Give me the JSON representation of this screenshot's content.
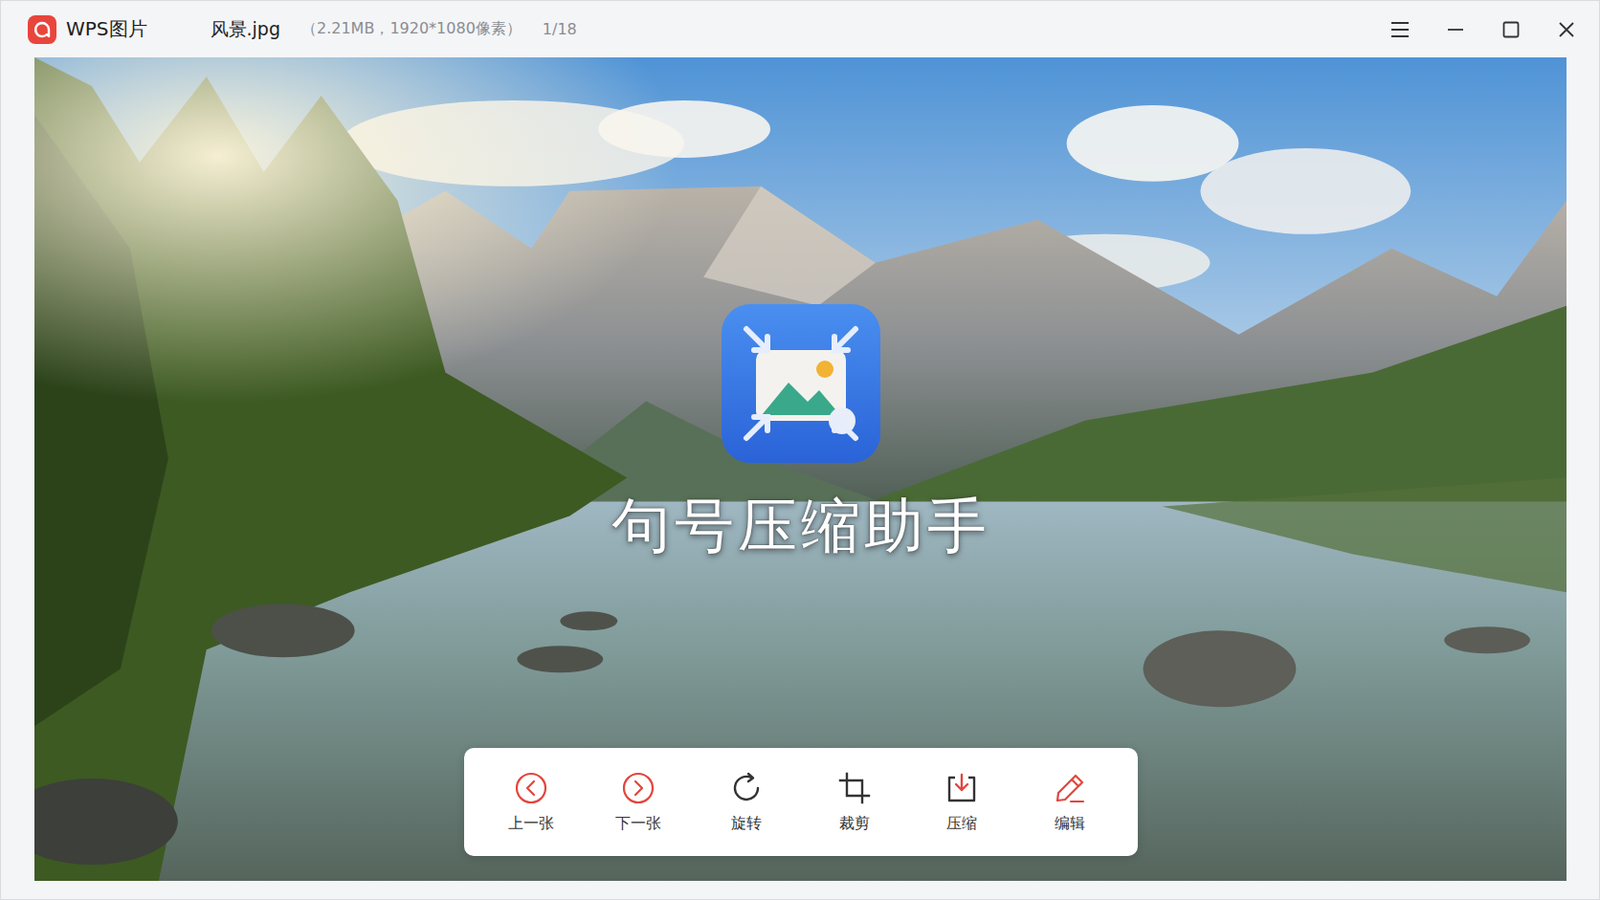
{
  "window": {
    "title": "WPS图片",
    "file_name": "风景.jpg",
    "file_info": "（2.21MB，1920*1080像素）",
    "counter": "1/18",
    "controls": [
      {
        "kind": "menu"
      },
      {
        "kind": "minimize"
      },
      {
        "kind": "maximize"
      },
      {
        "kind": "close"
      }
    ]
  },
  "watermark": {
    "text": "句号压缩助手"
  },
  "toolbar": [
    {
      "label": "上一张",
      "kind": "prev"
    },
    {
      "label": "下一张",
      "kind": "next"
    },
    {
      "label": "旋转",
      "kind": "rotate"
    },
    {
      "label": "裁剪",
      "kind": "crop"
    },
    {
      "label": "压缩",
      "kind": "compress"
    },
    {
      "label": "编辑",
      "kind": "edit"
    }
  ]
}
